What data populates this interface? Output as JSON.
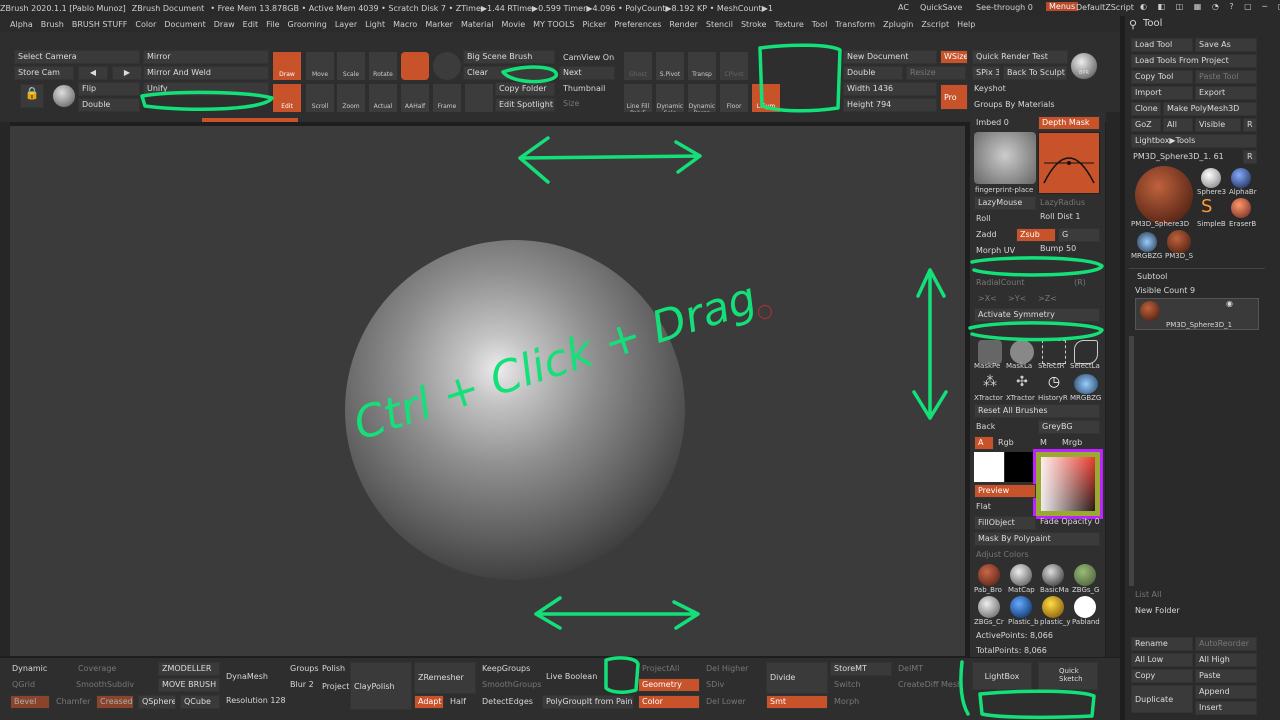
{
  "titlebar": {
    "app": "ZBrush 2020.1.1 [Pablo Munoz]",
    "doc": "ZBrush Document",
    "stats": "• Free Mem 13.878GB • Active Mem 4039 • Scratch Disk 7 • ZTime▶1.44 RTime▶0.599 Timer▶4.096 • PolyCount▶8.192 KP • MeshCount▶1",
    "ac": "AC",
    "quicksave": "QuickSave",
    "seethrough": "See-through 0",
    "menus": "Menus",
    "script": "DefaultZScript"
  },
  "menubar": [
    "Alpha",
    "Brush",
    "BRUSH STUFF",
    "Color",
    "Document",
    "Draw",
    "Edit",
    "File",
    "Grooming",
    "Layer",
    "Light",
    "Macro",
    "Marker",
    "Material",
    "Movie",
    "MY TOOLS",
    "Picker",
    "Preferences",
    "Render",
    "Stencil",
    "Stroke",
    "Texture",
    "Tool",
    "Transform",
    "Zplugin",
    "Zscript",
    "Help"
  ],
  "topshelf": {
    "select_camera": "Select Camera",
    "store_cam": "Store Cam",
    "mirror": "Mirror",
    "mirror_weld": "Mirror And Weld",
    "flip": "Flip",
    "double": "Double",
    "unify": "Unify",
    "draw": "Draw",
    "move": "Move",
    "scale": "Scale",
    "rotate": "Rotate",
    "edit": "Edit",
    "scroll": "Scroll",
    "zoom": "Zoom",
    "actual": "Actual",
    "aahalf": "AAHalf",
    "frame": "Frame",
    "big_scene": "Big Scene Brush",
    "clear": "Clear",
    "copy_folder": "Copy Folder",
    "edit_spotlight": "Edit Spotlight",
    "camview": "CamView On",
    "next": "Next",
    "thumbnail": "Thumbnail",
    "size": "Size",
    "shadow": "Ghost",
    "spivot": "S.Pivot",
    "transp": "Transp",
    "cpivot": "CPivot",
    "linefill": "Line Fill PolyF",
    "solo": "Dynamic Solo",
    "persp": "Dynamic Persp",
    "floor": "Floor",
    "lsym": "L.Sym",
    "new_document": "New Document",
    "wsize": "WSize",
    "double2": "Double",
    "resize": "Resize",
    "width": "Width 1436",
    "height": "Height 794",
    "pro": "Pro",
    "quick_render": "Quick Render Test",
    "spix": "SPix 3",
    "back_to_sculpt": "Back To Sculpt",
    "bpr": "BPR",
    "keyshot": "Keyshot",
    "groups_by_materials": "Groups By Materials"
  },
  "annotations": {
    "handwriting": "Ctrl + Click + Drag"
  },
  "rpanel": {
    "imbed": "Imbed 0",
    "depth_mask": "Depth Mask",
    "brush_name": "fingerprint-place",
    "lazymouse": "LazyMouse",
    "lazyradius": "LazyRadius",
    "roll": "Roll",
    "roll_dist": "Roll Dist 1",
    "zadd": "Zadd",
    "zsub": "Zsub",
    "g": "G",
    "morph_uv": "Morph UV",
    "bump": "Bump 50",
    "radialcount": "RadialCount",
    "r": "(R)",
    "x": ">X<",
    ">y": ">Y<",
    "z": ">Z<",
    "activate_symmetry": "Activate Symmetry",
    "b1": "MaskPe",
    "b2": "MaskLa",
    "b3": "SelectR",
    "b4": "SelectLa",
    "b5": "XTractor",
    "b6": "XTractor",
    "b7": "HistoryR",
    "b8": "MRGBZG",
    "reset_brushes": "Reset All Brushes",
    "back": "Back",
    "greybg": "GreyBG",
    "a": "A",
    "rgb": "Rgb",
    "m": "M",
    "mrgb": "Mrgb",
    "preview": "Preview",
    "flat": "Flat",
    "fillobject": "FillObject",
    "fade_opacity": "Fade Opacity 0",
    "mask_by_polypaint": "Mask By Polypaint",
    "adjust_colors": "Adjust Colors",
    "mats": [
      "Pab_Bro",
      "MatCap",
      "BasicMa",
      "ZBGs_G",
      "ZBGs_Cr",
      "Plastic_b",
      "plastic_y",
      "Pabland"
    ],
    "active_points": "ActivePoints: 8,066",
    "total_points": "TotalPoints: 8,066"
  },
  "tooltray": {
    "title": "Tool",
    "load_tool": "Load Tool",
    "save_as": "Save As",
    "load_from_project": "Load Tools From Project",
    "copy_tool": "Copy Tool",
    "paste_tool": "Paste Tool",
    "import": "Import",
    "export": "Export",
    "clone": "Clone",
    "make_polymesh": "Make PolyMesh3D",
    "goz": "GoZ",
    "all": "All",
    "visible": "Visible",
    "r": "R",
    "lightbox_tools": "Lightbox▶Tools",
    "current_tool": "PM3D_Sphere3D_1. 61",
    "r2": "R",
    "thumbs": [
      "PM3D_Sphere3D",
      "Sphere3",
      "AlphaBr",
      "SimpleB",
      "EraserB",
      "MRGBZG",
      "PM3D_S"
    ],
    "subtool": "Subtool",
    "visible_count": "Visible Count 9",
    "subtool_name": "PM3D_Sphere3D_1",
    "list_all": "List All",
    "new_folder": "New Folder",
    "rename": "Rename",
    "autoreorder": "AutoReorder",
    "all_low": "All Low",
    "all_high": "All High",
    "copy": "Copy",
    "paste": "Paste",
    "duplicate": "Duplicate",
    "append": "Append",
    "insert": "Insert"
  },
  "bottom": {
    "dynamic": "Dynamic",
    "coverage": "Coverage",
    "qgrid": "QGrid",
    "smoothsubdiv": "SmoothSubdiv",
    "bevel": "Bevel",
    "chamfer": "Chamfer",
    "creased": "Creased",
    "zmodeller": "ZMODELLER",
    "move_brush": "MOVE BRUSH",
    "qsphere": "QSphere",
    "qcube": "QCube",
    "dynamesh": "DynaMesh",
    "groups": "Groups",
    "polish": "Polish",
    "blur": "Blur 2",
    "project": "Project",
    "claypolish": "ClayPolish",
    "resolution": "Resolution 128",
    "zremesher": "ZRemesher",
    "adapt": "Adapt",
    "half": "Half",
    "keepgroups": "KeepGroups",
    "smoothgroups": "SmoothGroups",
    "detectedges": "DetectEdges",
    "live_boolean": "Live Boolean",
    "polygroupit": "PolyGroupIt from Paint",
    "projectall": "ProjectAll",
    "geometry": "Geometry",
    "color": "Color",
    "del_higher": "Del Higher",
    "sdiv": "SDiv",
    "del_lower": "Del Lower",
    "divide": "Divide",
    "smt": "Smt",
    "storemt": "StoreMT",
    "delmt": "DelMT",
    "switch": "Switch",
    "create_diff": "CreateDiff Mesh",
    "morph": "Morph",
    "lightbox": "LightBox",
    "quick_sketch": "Quick Sketch"
  },
  "colors": {
    "accent": "#c8532b",
    "annotation": "#14e07a"
  }
}
